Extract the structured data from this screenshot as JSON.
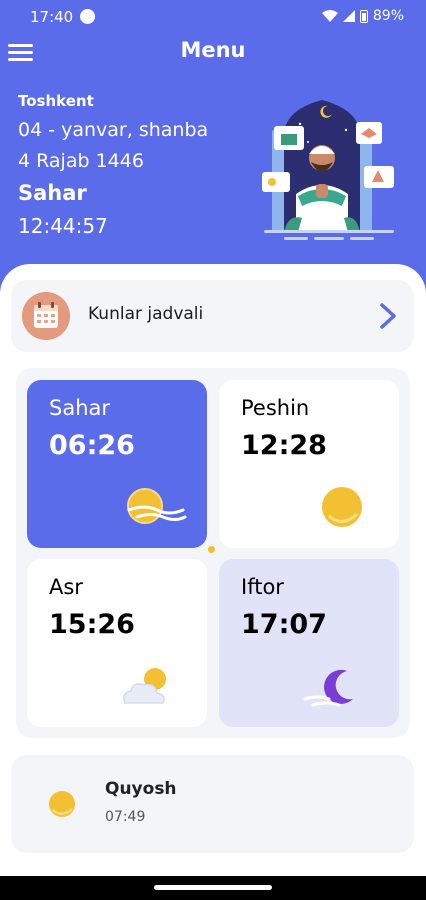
{
  "status_bar": {
    "time": "17:40",
    "battery": "89%"
  },
  "header": {
    "menu_icon": "hamburger-icon",
    "title": "Menu",
    "city": "Toshkent",
    "date": "04 - yanvar, shanba",
    "hijri_date": "4 Rajab 1446",
    "current_period": "Sahar",
    "clock": "12:44:57"
  },
  "calendar_link": {
    "label": "Kunlar jadvali",
    "icon": "calendar-icon",
    "arrow_icon": "chevron-right-icon"
  },
  "prayers": [
    {
      "name": "Sahar",
      "time": "06:26",
      "icon": "sunrise-wind-icon",
      "state": "active"
    },
    {
      "name": "Peshin",
      "time": "12:28",
      "icon": "sun-icon",
      "state": "normal"
    },
    {
      "name": "Asr",
      "time": "15:26",
      "icon": "sun-cloud-icon",
      "state": "normal"
    },
    {
      "name": "Iftor",
      "time": "17:07",
      "icon": "moon-icon",
      "state": "upcoming"
    }
  ],
  "sunrise": {
    "name": "Quyosh",
    "time": "07:49",
    "icon": "sun-icon"
  },
  "colors": {
    "primary": "#5b6cea",
    "highlight": "#e1e4f8",
    "card": "#f4f5f8",
    "sun": "#f2c032"
  }
}
